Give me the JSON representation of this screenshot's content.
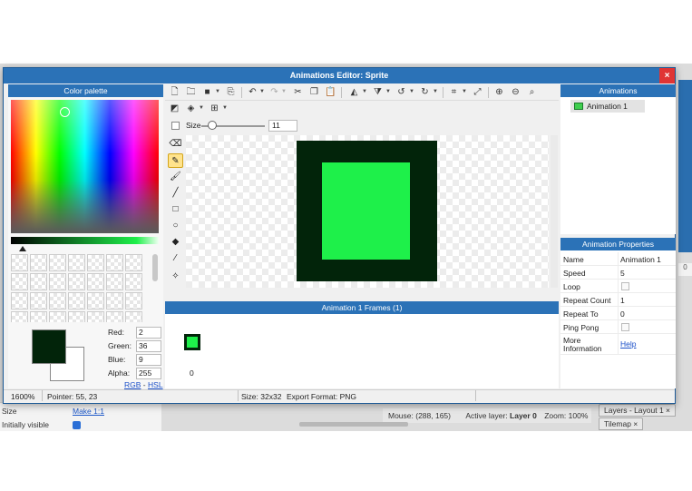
{
  "background": {
    "size_label": "Size",
    "make_link": "Make 1:1",
    "initially_visible_label": "Initially visible",
    "mouse": "Mouse: (288, 165)",
    "active_layer_prefix": "Active layer:",
    "active_layer": "Layer 0",
    "zoom": "Zoom: 100%",
    "tab_layers": "Layers - Layout 1",
    "tab_tilemap": "Tilemap",
    "side_value": "0"
  },
  "dialog": {
    "title": "Animations Editor: Sprite",
    "close": "×"
  },
  "palette": {
    "title": "Color palette",
    "red_label": "Red:",
    "red": "2",
    "green_label": "Green:",
    "green": "36",
    "blue_label": "Blue:",
    "blue": "9",
    "alpha_label": "Alpha:",
    "alpha": "255",
    "rgb_link": "RGB",
    "separator": "-",
    "hsl_link": "HSL",
    "primary_color": "#02240a",
    "secondary_color": "#ffffff"
  },
  "toolbar": {
    "size_label": "Size",
    "size_value": "11"
  },
  "frames": {
    "title": "Animation 1 Frames (1)",
    "frame_index": "0"
  },
  "animations": {
    "title": "Animations",
    "items": [
      {
        "label": "Animation 1"
      }
    ]
  },
  "properties": {
    "title": "Animation Properties",
    "rows": [
      {
        "name": "Name",
        "value": "Animation 1"
      },
      {
        "name": "Speed",
        "value": "5"
      },
      {
        "name": "Loop",
        "value": ""
      },
      {
        "name": "Repeat Count",
        "value": "1"
      },
      {
        "name": "Repeat To",
        "value": "0"
      },
      {
        "name": "Ping Pong",
        "value": ""
      },
      {
        "name": "More Information",
        "value": "Help"
      }
    ]
  },
  "status": {
    "zoom": "1600%",
    "pointer": "Pointer: 55, 23",
    "size": "Size: 32x32",
    "export": "Export Format: PNG"
  },
  "colors": {
    "titlebar": "#2b72b7",
    "close": "#e03434",
    "sprite_border": "#02240a",
    "sprite_fill": "#1ef04a"
  }
}
